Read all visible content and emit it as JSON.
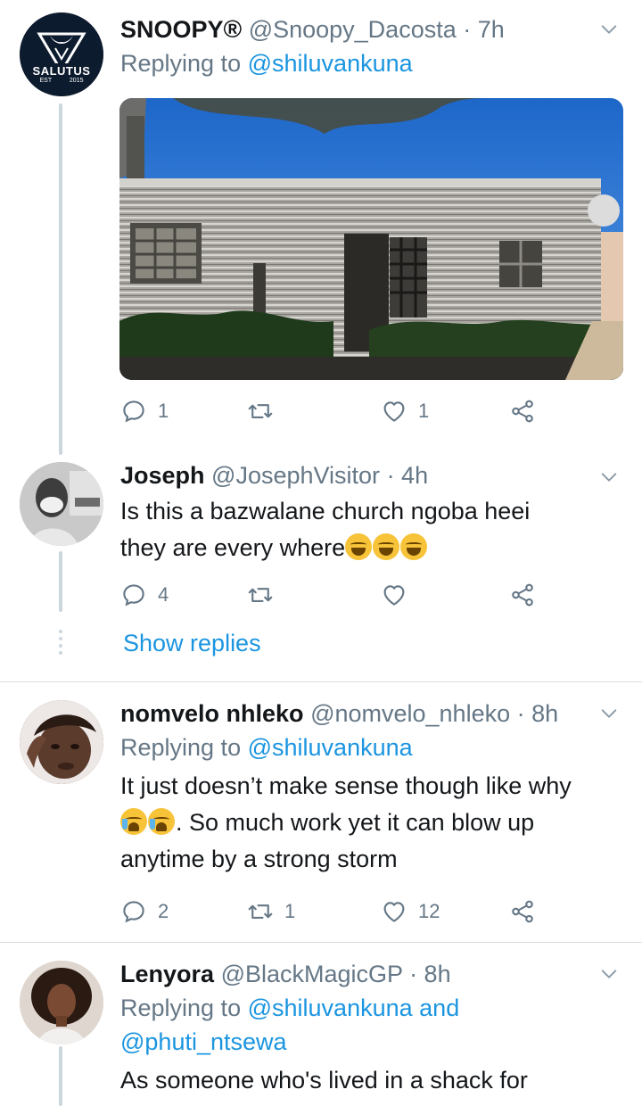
{
  "tweets": [
    {
      "name": "SNOOPY",
      "verified_mark": "®",
      "handle": "@Snoopy_Dacosta",
      "time": "· 7h",
      "replying_prefix": "Replying to",
      "replying_to": "@shiluvankuna",
      "avatar_text": "SALUTUS",
      "avatar_sub_left": "EST",
      "avatar_sub_right": "2015",
      "replies": "1",
      "retweets": "",
      "likes": "1"
    },
    {
      "name": "Joseph",
      "handle": "@JosephVisitor",
      "time": "· 4h",
      "text_line1": "Is this a bazwalane church ngoba heei",
      "text_line2": "they are every where",
      "replies": "4",
      "retweets": "",
      "likes": "",
      "show_replies": "Show replies"
    },
    {
      "name": "nomvelo nhleko",
      "handle": "@nomvelo_nhleko",
      "time": "· 8h",
      "replying_prefix": "Replying to",
      "replying_to": "@shiluvankuna",
      "text_line1": "It just doesn’t make sense though like why",
      "text_line2": ". So much work yet it can blow up",
      "text_line3": "anytime by a strong storm",
      "replies": "2",
      "retweets": "1",
      "likes": "12"
    },
    {
      "name": "Lenyora",
      "handle": "@BlackMagicGP",
      "time": "· 8h",
      "replying_prefix": "Replying to",
      "replying_to": "@shiluvankuna",
      "replying_and": "and",
      "replying_to_2": "@phuti_ntsewa",
      "text_line1": "As someone who's lived in a shack for"
    }
  ],
  "icons": {
    "reply": "reply-icon",
    "retweet": "retweet-icon",
    "like": "heart-icon",
    "share": "share-icon",
    "caret": "chevron-down-icon"
  },
  "colors": {
    "link": "#1b95e0",
    "secondary": "#657786",
    "text": "#14171a",
    "divider": "#d8dde2"
  }
}
